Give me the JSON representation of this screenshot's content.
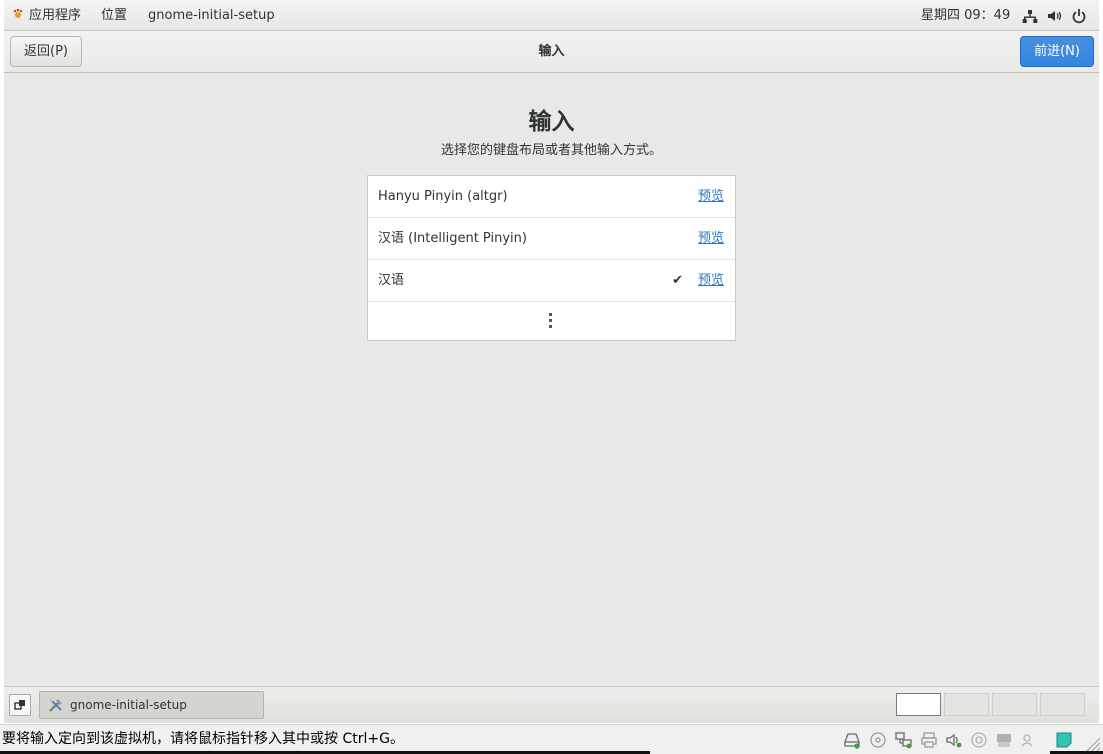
{
  "top_panel": {
    "applications_label": "应用程序",
    "places_label": "位置",
    "app_name": "gnome-initial-setup",
    "clock": "星期四 09：49"
  },
  "header": {
    "back_label": "返回(P)",
    "title": "输入",
    "next_label": "前进(N)"
  },
  "main": {
    "heading": "输入",
    "subtitle": "选择您的键盘布局或者其他输入方式。",
    "sources": [
      {
        "label": "Hanyu Pinyin (altgr)",
        "preview": "预览",
        "selected": false
      },
      {
        "label": "汉语 (Intelligent Pinyin)",
        "preview": "预览",
        "selected": false
      },
      {
        "label": "汉语",
        "preview": "预览",
        "selected": true,
        "check": "✔"
      }
    ]
  },
  "bottom_panel": {
    "task_label": "gnome-initial-setup",
    "workspace_count": 4,
    "active_workspace": 1
  },
  "host_status": {
    "message": "要将输入定向到该虚拟机，请将鼠标指针移入其中或按 Ctrl+G。"
  },
  "colors": {
    "accent": "#3584e4",
    "link": "#2a76c6",
    "background": "#e8e8e7"
  }
}
